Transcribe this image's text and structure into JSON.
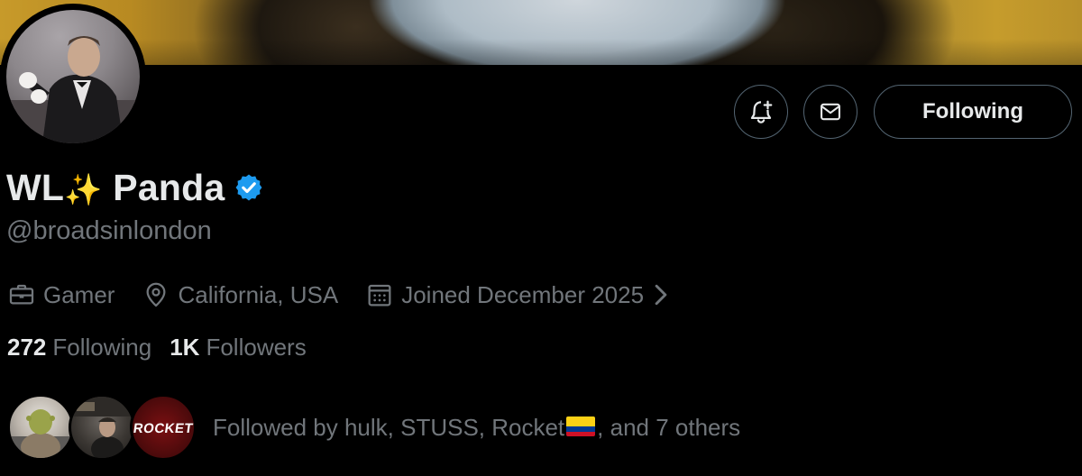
{
  "profile": {
    "display_name_prefix": "WL",
    "display_name_emoji": "✨",
    "display_name_suffix": "Panda",
    "handle": "@broadsinlondon",
    "verified": true,
    "verified_color": "#1d9bf0"
  },
  "actions": {
    "notify_icon": "bell-plus-icon",
    "message_icon": "envelope-icon",
    "following_label": "Following"
  },
  "meta": {
    "profession": "Gamer",
    "location": "California, USA",
    "joined": "Joined December 2025"
  },
  "counts": {
    "following_count": "272",
    "following_label": "Following",
    "followers_count": "1K",
    "followers_label": "Followers"
  },
  "followed_by": {
    "avatar_labels": [
      "ROCKET"
    ],
    "prefix": "Followed by hulk, STUSS, Rocket",
    "flag_icon": "colombia-flag-icon",
    "suffix": ", and 7 others"
  },
  "colors": {
    "background": "#000000",
    "primary_text": "#e7e9ea",
    "secondary_text": "#71767b",
    "border": "#536471"
  }
}
